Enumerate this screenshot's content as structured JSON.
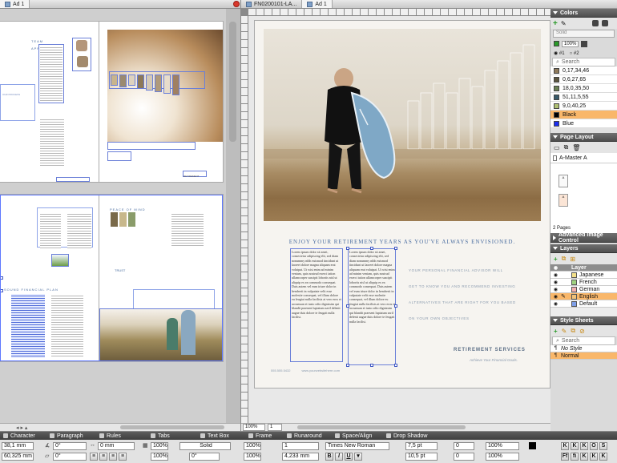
{
  "left_tab": {
    "label": "Ad 1"
  },
  "right_tabs": [
    {
      "label": "FN0200101-LA..."
    },
    {
      "label": "Ad 1"
    }
  ],
  "left_page": {
    "spread1_heading": "TEAM APPROACH",
    "spread1_side_heading": "OUR PROCESS",
    "spread1_corner_heading": "RETIREMENT",
    "spread2_heading": "PEACE OF MIND",
    "spread2_left_heading": "SOUND FINANCIAL PLAN",
    "spread2_mid_heading": "TRUST"
  },
  "ad": {
    "headline": "ENJOY YOUR RETIREMENT YEARS AS YOU'VE ALWAYS ENVISIONED.",
    "col1": "Lorem ipsum dolor sit amet, consectetur adipiscing elit, sed diam nonummy nibh euismod tincidunt ut laoreet dolore magna aliquam erat volutpat. Ut wisi enim ad minim veniam, quis nostrud exerci tation ullamcorper suscipit lobortis nisl ut aliquip ex ea commodo consequat. Duis autem vel eum iriure dolor in hendrerit in vulputate velit esse molestie consequat, vel illum dolore eu feugiat nulla facilisis at vero eros et accumsan et iusto odio dignissim qui blandit praesent luptatum zzril delenit augue duis dolore te feugait nulla facilisi.",
    "col2": "Lorem ipsum dolor sit amet, consectetur adipiscing elit, sed diam nonummy nibh euismod tincidunt ut laoreet dolore magna aliquam erat volutpat. Ut wisi enim ad minim veniam, quis nostrud exerci tation ullamcorper suscipit lobortis nisl ut aliquip ex ea commodo consequat. Duis autem vel eum iriure dolor in hendrerit in vulputate velit esse molestie consequat, vel illum dolore eu feugiat nulla facilisis at vero eros et accumsan et iusto odio dignissim qui blandit praesent luptatum zzril delenit augue duis dolore te feugait nulla facilisi.",
    "side_lines": [
      "YOUR PERSONAL FINANCIAL ADVISOR WILL",
      "GET TO KNOW YOU AND RECOMMEND INVESTING",
      "ALTERNATIVES THAT ARE RIGHT FOR YOU BASED",
      "ON YOUR OWN OBJECTIVES"
    ],
    "brand": "RETIREMENT SERVICES",
    "tagline": "Achieve Your Financial Goals.",
    "phone": "555.555.5432",
    "url": "www.yourwebsitehere.com"
  },
  "zoom": "100%",
  "page_num": "1",
  "colors": {
    "title": "Colors",
    "mode": "Solid",
    "opacity": "100%",
    "tint_a": "#1",
    "tint_b": "#2",
    "search": "Search",
    "items": [
      {
        "name": "0,17,34,46",
        "hex": "#8f7a5c"
      },
      {
        "name": "0,6,27,65",
        "hex": "#5c5640"
      },
      {
        "name": "18,0,35,50",
        "hex": "#6a8054"
      },
      {
        "name": "51,11,5,55",
        "hex": "#375a6a"
      },
      {
        "name": "9,0,40,25",
        "hex": "#aebf73"
      },
      {
        "name": "Black",
        "hex": "#000000"
      },
      {
        "name": "Blue",
        "hex": "#1a2ef0"
      }
    ],
    "selected": "Black",
    "selected_bg": "#f9b76a"
  },
  "page_layout": {
    "title": "Page Layout",
    "master": "A-Master A",
    "page_a": "A",
    "page_b": "A",
    "pages": "2 Pages"
  },
  "adv_image": {
    "title": "Advanced Image Control"
  },
  "layers": {
    "title": "Layers",
    "header": "Layer",
    "items": [
      {
        "name": "Japanese",
        "hex": "#f3e08a"
      },
      {
        "name": "French",
        "hex": "#9fd27f"
      },
      {
        "name": "German",
        "hex": "#f4b0b0"
      },
      {
        "name": "English",
        "hex": "#f1c27a"
      },
      {
        "name": "Default",
        "hex": "#7f9fe8"
      }
    ],
    "selected": "English"
  },
  "style_sheets": {
    "title": "Style Sheets",
    "search": "Search",
    "items": [
      "No Style",
      "Normal"
    ],
    "selected": "Normal"
  },
  "measure": {
    "tabs": [
      "Character",
      "Paragraph",
      "Rules",
      "Tabs",
      "Text Box",
      "Frame",
      "Runaround",
      "Space/Align",
      "Drop Shadow"
    ],
    "x": "38,1 mm",
    "y": "60,325 mm",
    "angle1": "0°",
    "angle2": "0°",
    "w": "0 mm",
    "h": "0 mm",
    "pct1": "100%",
    "pct2": "100%",
    "frame_style": "Solid",
    "frame_w": "0°",
    "pct3": "100%",
    "pct4": "100%",
    "cols": "1",
    "gutter": "4,233 mm",
    "font": "Times New Roman",
    "size": "7,5 pt",
    "leading": "10,5 pt",
    "track": "0",
    "track2": "0",
    "scale1": "100%",
    "scale2": "100%"
  }
}
